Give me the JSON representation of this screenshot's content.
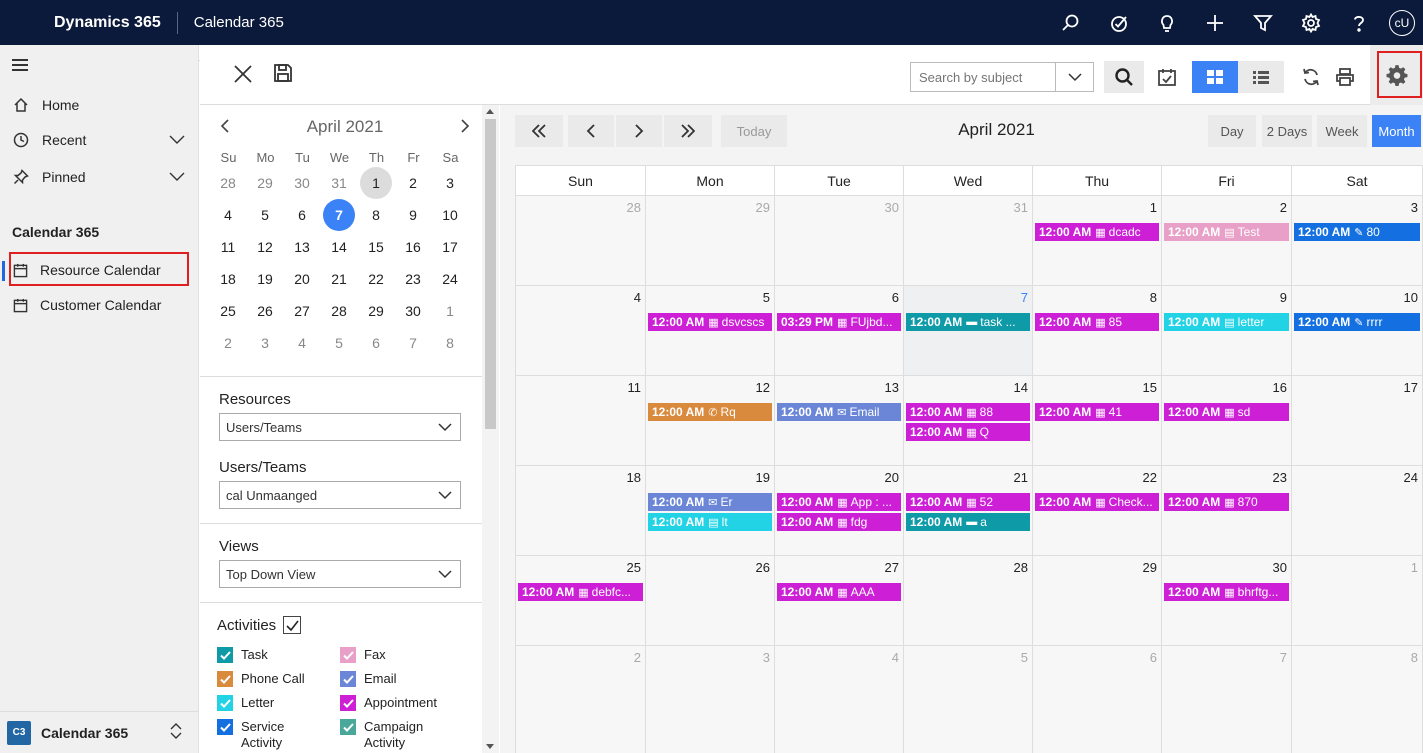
{
  "topbar": {
    "brand": "Dynamics 365",
    "app_title": "Calendar 365",
    "avatar": "cU"
  },
  "nav": {
    "home": "Home",
    "recent": "Recent",
    "pinned": "Pinned",
    "section": "Calendar 365",
    "resource_calendar": "Resource Calendar",
    "customer_calendar": "Customer Calendar",
    "area_badge": "C3",
    "area_name": "Calendar 365"
  },
  "toolbar": {
    "search_placeholder": "Search by subject"
  },
  "mini_calendar": {
    "title": "April 2021",
    "weekdays": [
      "Su",
      "Mo",
      "Tu",
      "We",
      "Th",
      "Fr",
      "Sa"
    ],
    "weeks": [
      [
        "28",
        "29",
        "30",
        "31",
        "1",
        "2",
        "3"
      ],
      [
        "4",
        "5",
        "6",
        "7",
        "8",
        "9",
        "10"
      ],
      [
        "11",
        "12",
        "13",
        "14",
        "15",
        "16",
        "17"
      ],
      [
        "18",
        "19",
        "20",
        "21",
        "22",
        "23",
        "24"
      ],
      [
        "25",
        "26",
        "27",
        "28",
        "29",
        "30",
        "1"
      ],
      [
        "2",
        "3",
        "4",
        "5",
        "6",
        "7",
        "8"
      ]
    ]
  },
  "filters": {
    "resources_label": "Resources",
    "resources_value": "Users/Teams",
    "users_label": "Users/Teams",
    "users_value": "cal Unmaanged",
    "views_label": "Views",
    "views_value": "Top Down View",
    "activities_label": "Activities"
  },
  "activities": [
    {
      "label": "Task",
      "color": "#0f9aa8"
    },
    {
      "label": "Fax",
      "color": "#e8a0c8"
    },
    {
      "label": "Phone Call",
      "color": "#d98a3d"
    },
    {
      "label": "Email",
      "color": "#6b86d6"
    },
    {
      "label": "Letter",
      "color": "#22d3e6"
    },
    {
      "label": "Appointment",
      "color": "#cc1fd6"
    },
    {
      "label": "Service Activity",
      "color": "#1470e0"
    },
    {
      "label": "Campaign Activity",
      "color": "#4aa89a"
    }
  ],
  "calendar": {
    "title": "April 2021",
    "today_label": "Today",
    "views": [
      "Day",
      "2 Days",
      "Week",
      "Month"
    ],
    "weekdays": [
      "Sun",
      "Mon",
      "Tue",
      "Wed",
      "Thu",
      "Fri",
      "Sat"
    ],
    "weeks": [
      [
        "28",
        "29",
        "30",
        "31",
        "1",
        "2",
        "3"
      ],
      [
        "4",
        "5",
        "6",
        "7",
        "8",
        "9",
        "10"
      ],
      [
        "11",
        "12",
        "13",
        "14",
        "15",
        "16",
        "17"
      ],
      [
        "18",
        "19",
        "20",
        "21",
        "22",
        "23",
        "24"
      ],
      [
        "25",
        "26",
        "27",
        "28",
        "29",
        "30",
        "1"
      ],
      [
        "2",
        "3",
        "4",
        "5",
        "6",
        "7",
        "8"
      ]
    ],
    "events": [
      {
        "week": 0,
        "day": 4,
        "slot": 0,
        "time": "12:00 AM",
        "glyph": "▦",
        "text": "dcadc",
        "color": "#cc1fd6"
      },
      {
        "week": 0,
        "day": 5,
        "slot": 0,
        "time": "12:00 AM",
        "glyph": "▤",
        "text": "Test",
        "color": "#e8a0c8"
      },
      {
        "week": 0,
        "day": 6,
        "slot": 0,
        "time": "12:00 AM",
        "glyph": "✎",
        "text": "80",
        "color": "#1470e0"
      },
      {
        "week": 1,
        "day": 1,
        "slot": 0,
        "time": "12:00 AM",
        "glyph": "▦",
        "text": "dsvcscs",
        "color": "#cc1fd6"
      },
      {
        "week": 1,
        "day": 2,
        "slot": 0,
        "time": "03:29 PM",
        "glyph": "▦",
        "text": "FUjbd...",
        "color": "#cc1fd6"
      },
      {
        "week": 1,
        "day": 3,
        "slot": 0,
        "time": "12:00 AM",
        "glyph": "▬",
        "text": "task ...",
        "color": "#0f9aa8"
      },
      {
        "week": 1,
        "day": 4,
        "slot": 0,
        "time": "12:00 AM",
        "glyph": "▦",
        "text": "85",
        "color": "#cc1fd6"
      },
      {
        "week": 1,
        "day": 5,
        "slot": 0,
        "time": "12:00 AM",
        "glyph": "▤",
        "text": "letter",
        "color": "#22d3e6"
      },
      {
        "week": 1,
        "day": 6,
        "slot": 0,
        "time": "12:00 AM",
        "glyph": "✎",
        "text": "rrrr",
        "color": "#1470e0"
      },
      {
        "week": 2,
        "day": 1,
        "slot": 0,
        "time": "12:00 AM",
        "glyph": "✆",
        "text": "Rq",
        "color": "#d98a3d"
      },
      {
        "week": 2,
        "day": 2,
        "slot": 0,
        "time": "12:00 AM",
        "glyph": "✉",
        "text": "Email",
        "color": "#6b86d6"
      },
      {
        "week": 2,
        "day": 3,
        "slot": 0,
        "time": "12:00 AM",
        "glyph": "▦",
        "text": "88",
        "color": "#cc1fd6"
      },
      {
        "week": 2,
        "day": 3,
        "slot": 1,
        "time": "12:00 AM",
        "glyph": "▦",
        "text": "Q",
        "color": "#cc1fd6"
      },
      {
        "week": 2,
        "day": 4,
        "slot": 0,
        "time": "12:00 AM",
        "glyph": "▦",
        "text": "41",
        "color": "#cc1fd6"
      },
      {
        "week": 2,
        "day": 5,
        "slot": 0,
        "time": "12:00 AM",
        "glyph": "▦",
        "text": "sd",
        "color": "#cc1fd6"
      },
      {
        "week": 3,
        "day": 1,
        "slot": 0,
        "time": "12:00 AM",
        "glyph": "✉",
        "text": "Er",
        "color": "#6b86d6"
      },
      {
        "week": 3,
        "day": 1,
        "slot": 1,
        "time": "12:00 AM",
        "glyph": "▤",
        "text": "lt",
        "color": "#22d3e6"
      },
      {
        "week": 3,
        "day": 2,
        "slot": 0,
        "time": "12:00 AM",
        "glyph": "▦",
        "text": "App : ...",
        "color": "#cc1fd6"
      },
      {
        "week": 3,
        "day": 2,
        "slot": 1,
        "time": "12:00 AM",
        "glyph": "▦",
        "text": "fdg",
        "color": "#cc1fd6"
      },
      {
        "week": 3,
        "day": 3,
        "slot": 0,
        "time": "12:00 AM",
        "glyph": "▦",
        "text": "52",
        "color": "#cc1fd6"
      },
      {
        "week": 3,
        "day": 3,
        "slot": 1,
        "time": "12:00 AM",
        "glyph": "▬",
        "text": "a",
        "color": "#0f9aa8"
      },
      {
        "week": 3,
        "day": 4,
        "slot": 0,
        "time": "12:00 AM",
        "glyph": "▦",
        "text": "Check...",
        "color": "#cc1fd6"
      },
      {
        "week": 3,
        "day": 5,
        "slot": 0,
        "time": "12:00 AM",
        "glyph": "▦",
        "text": "870",
        "color": "#cc1fd6"
      },
      {
        "week": 4,
        "day": 0,
        "slot": 0,
        "time": "12:00 AM",
        "glyph": "▦",
        "text": "debfc...",
        "color": "#cc1fd6"
      },
      {
        "week": 4,
        "day": 2,
        "slot": 0,
        "time": "12:00 AM",
        "glyph": "▦",
        "text": "AAA",
        "color": "#cc1fd6"
      },
      {
        "week": 4,
        "day": 5,
        "slot": 0,
        "time": "12:00 AM",
        "glyph": "▦",
        "text": "bhrftg...",
        "color": "#cc1fd6"
      }
    ]
  }
}
